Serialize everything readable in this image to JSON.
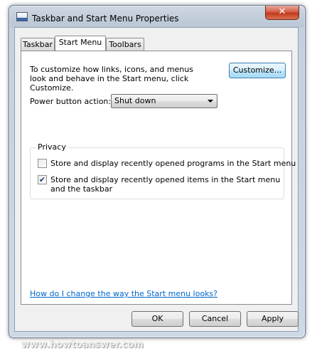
{
  "window": {
    "title": "Taskbar and Start Menu Properties",
    "close_glyph": "✕",
    "title_icon": "taskbar-properties-icon"
  },
  "tabs": [
    {
      "label": "Taskbar",
      "active": false
    },
    {
      "label": "Start Menu",
      "active": true
    },
    {
      "label": "Toolbars",
      "active": false
    }
  ],
  "start_menu": {
    "intro_text": "To customize how links, icons, and menus look and behave in the Start menu, click Customize.",
    "customize_label": "Customize...",
    "power_label": "Power button action:",
    "power_value": "Shut down",
    "privacy": {
      "title": "Privacy",
      "items": [
        {
          "label": "Store and display recently opened programs in the Start menu",
          "checked": false
        },
        {
          "label": "Store and display recently opened items in the Start menu and the taskbar",
          "checked": true
        }
      ]
    },
    "help_link": "How do I change the way the Start menu looks?"
  },
  "buttons": {
    "ok": "OK",
    "cancel": "Cancel",
    "apply": "Apply"
  },
  "watermark": "www.howtoanswer.com",
  "check_glyph": "✔"
}
